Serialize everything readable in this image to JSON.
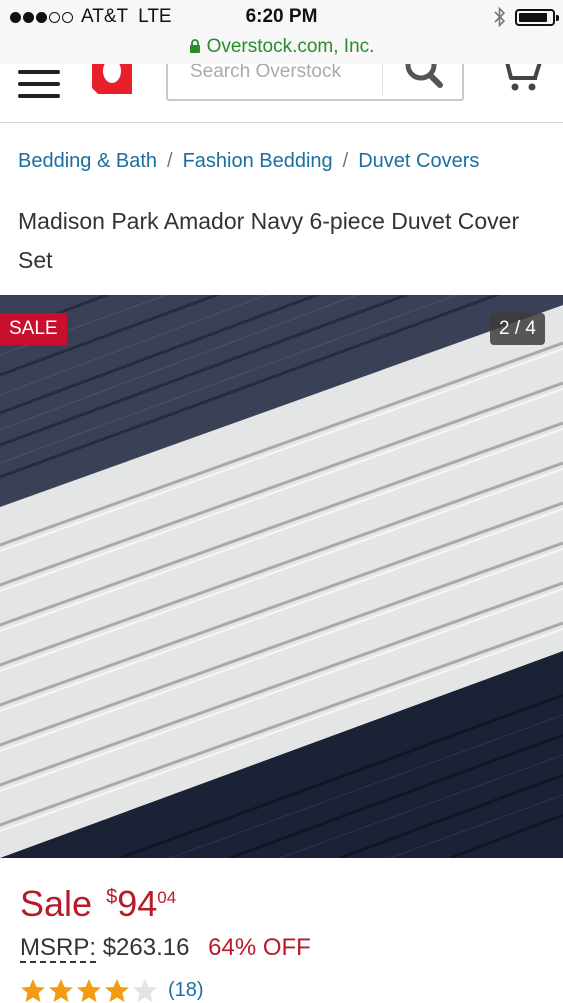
{
  "status_bar": {
    "signal_bars_filled": 3,
    "signal_bars_total": 5,
    "carrier": "AT&T",
    "network": "LTE",
    "time": "6:20 PM",
    "battery_level": 0.8
  },
  "browser": {
    "url_text": "Overstock.com, Inc."
  },
  "header": {
    "search_placeholder": "Search Overstock",
    "logo_color": "#e8202a"
  },
  "breadcrumb": {
    "items": [
      "Bedding & Bath",
      "Fashion Bedding",
      "Duvet Covers"
    ],
    "separator": "/"
  },
  "product": {
    "title": "Madison Park Amador Navy 6-piece Duvet Cover Set",
    "sale_badge": "SALE",
    "image_counter": "2 / 4",
    "sale_label": "Sale",
    "currency_symbol": "$",
    "price_dollars": "94",
    "price_cents": "04",
    "msrp_label": "MSRP:",
    "msrp_value": "$263.16",
    "discount": "64% OFF",
    "rating": 4,
    "rating_max": 5,
    "review_count": "(18)"
  },
  "colors": {
    "accent_red": "#b81a2a",
    "link_blue": "#1a6f9f",
    "star_orange": "#f39c12",
    "secure_green": "#2a8c2a"
  }
}
